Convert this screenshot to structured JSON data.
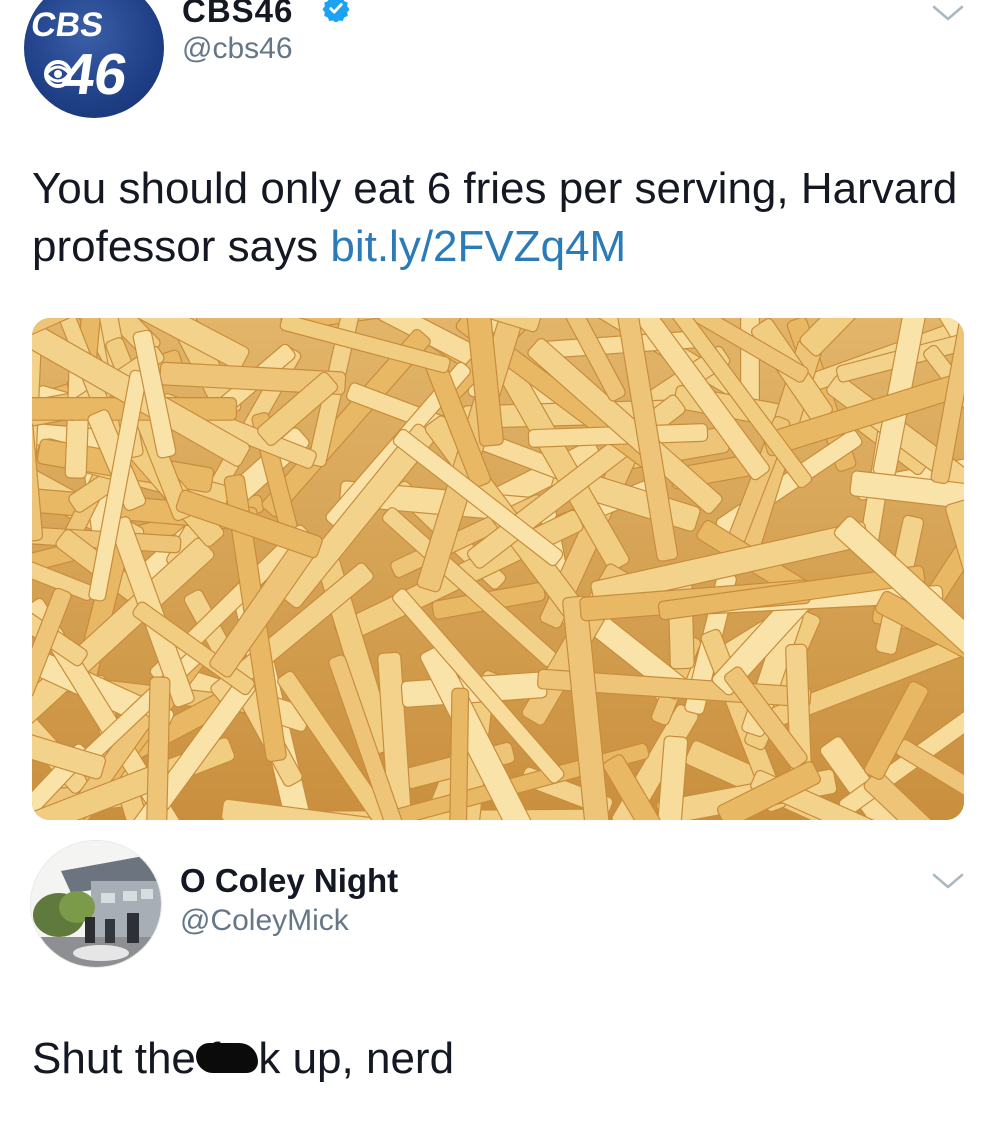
{
  "tweet_1": {
    "display_name": "CBS46",
    "handle": "@cbs46",
    "avatar_text": "CBS 46",
    "text": "You should only eat 6 fries per serving, Harvard professor says",
    "link": "bit.ly/2FVZq4M",
    "media": "fries photo"
  },
  "tweet_2": {
    "display_name": "O Coley Night",
    "handle": "@ColeyMick",
    "text_before": "Shut the f",
    "text_after": "k up, nerd"
  },
  "icons": {
    "verified": "verified-badge-icon",
    "menu": "chevron-down-icon"
  },
  "colors": {
    "link": "#2b7bb9",
    "verified": "#1da1f2",
    "handle": "#657786",
    "cbs_blue": "#1f3f86"
  }
}
